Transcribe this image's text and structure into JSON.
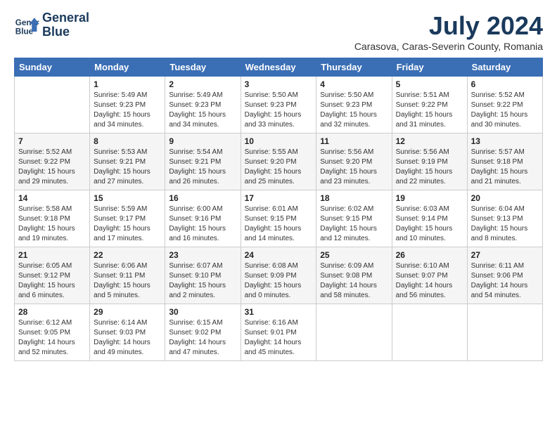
{
  "header": {
    "logo_line1": "General",
    "logo_line2": "Blue",
    "month": "July 2024",
    "location": "Carasova, Caras-Severin County, Romania"
  },
  "days_of_week": [
    "Sunday",
    "Monday",
    "Tuesday",
    "Wednesday",
    "Thursday",
    "Friday",
    "Saturday"
  ],
  "weeks": [
    [
      {
        "day": "",
        "content": ""
      },
      {
        "day": "1",
        "content": "Sunrise: 5:49 AM\nSunset: 9:23 PM\nDaylight: 15 hours\nand 34 minutes."
      },
      {
        "day": "2",
        "content": "Sunrise: 5:49 AM\nSunset: 9:23 PM\nDaylight: 15 hours\nand 34 minutes."
      },
      {
        "day": "3",
        "content": "Sunrise: 5:50 AM\nSunset: 9:23 PM\nDaylight: 15 hours\nand 33 minutes."
      },
      {
        "day": "4",
        "content": "Sunrise: 5:50 AM\nSunset: 9:23 PM\nDaylight: 15 hours\nand 32 minutes."
      },
      {
        "day": "5",
        "content": "Sunrise: 5:51 AM\nSunset: 9:22 PM\nDaylight: 15 hours\nand 31 minutes."
      },
      {
        "day": "6",
        "content": "Sunrise: 5:52 AM\nSunset: 9:22 PM\nDaylight: 15 hours\nand 30 minutes."
      }
    ],
    [
      {
        "day": "7",
        "content": "Sunrise: 5:52 AM\nSunset: 9:22 PM\nDaylight: 15 hours\nand 29 minutes."
      },
      {
        "day": "8",
        "content": "Sunrise: 5:53 AM\nSunset: 9:21 PM\nDaylight: 15 hours\nand 27 minutes."
      },
      {
        "day": "9",
        "content": "Sunrise: 5:54 AM\nSunset: 9:21 PM\nDaylight: 15 hours\nand 26 minutes."
      },
      {
        "day": "10",
        "content": "Sunrise: 5:55 AM\nSunset: 9:20 PM\nDaylight: 15 hours\nand 25 minutes."
      },
      {
        "day": "11",
        "content": "Sunrise: 5:56 AM\nSunset: 9:20 PM\nDaylight: 15 hours\nand 23 minutes."
      },
      {
        "day": "12",
        "content": "Sunrise: 5:56 AM\nSunset: 9:19 PM\nDaylight: 15 hours\nand 22 minutes."
      },
      {
        "day": "13",
        "content": "Sunrise: 5:57 AM\nSunset: 9:18 PM\nDaylight: 15 hours\nand 21 minutes."
      }
    ],
    [
      {
        "day": "14",
        "content": "Sunrise: 5:58 AM\nSunset: 9:18 PM\nDaylight: 15 hours\nand 19 minutes."
      },
      {
        "day": "15",
        "content": "Sunrise: 5:59 AM\nSunset: 9:17 PM\nDaylight: 15 hours\nand 17 minutes."
      },
      {
        "day": "16",
        "content": "Sunrise: 6:00 AM\nSunset: 9:16 PM\nDaylight: 15 hours\nand 16 minutes."
      },
      {
        "day": "17",
        "content": "Sunrise: 6:01 AM\nSunset: 9:15 PM\nDaylight: 15 hours\nand 14 minutes."
      },
      {
        "day": "18",
        "content": "Sunrise: 6:02 AM\nSunset: 9:15 PM\nDaylight: 15 hours\nand 12 minutes."
      },
      {
        "day": "19",
        "content": "Sunrise: 6:03 AM\nSunset: 9:14 PM\nDaylight: 15 hours\nand 10 minutes."
      },
      {
        "day": "20",
        "content": "Sunrise: 6:04 AM\nSunset: 9:13 PM\nDaylight: 15 hours\nand 8 minutes."
      }
    ],
    [
      {
        "day": "21",
        "content": "Sunrise: 6:05 AM\nSunset: 9:12 PM\nDaylight: 15 hours\nand 6 minutes."
      },
      {
        "day": "22",
        "content": "Sunrise: 6:06 AM\nSunset: 9:11 PM\nDaylight: 15 hours\nand 5 minutes."
      },
      {
        "day": "23",
        "content": "Sunrise: 6:07 AM\nSunset: 9:10 PM\nDaylight: 15 hours\nand 2 minutes."
      },
      {
        "day": "24",
        "content": "Sunrise: 6:08 AM\nSunset: 9:09 PM\nDaylight: 15 hours\nand 0 minutes."
      },
      {
        "day": "25",
        "content": "Sunrise: 6:09 AM\nSunset: 9:08 PM\nDaylight: 14 hours\nand 58 minutes."
      },
      {
        "day": "26",
        "content": "Sunrise: 6:10 AM\nSunset: 9:07 PM\nDaylight: 14 hours\nand 56 minutes."
      },
      {
        "day": "27",
        "content": "Sunrise: 6:11 AM\nSunset: 9:06 PM\nDaylight: 14 hours\nand 54 minutes."
      }
    ],
    [
      {
        "day": "28",
        "content": "Sunrise: 6:12 AM\nSunset: 9:05 PM\nDaylight: 14 hours\nand 52 minutes."
      },
      {
        "day": "29",
        "content": "Sunrise: 6:14 AM\nSunset: 9:03 PM\nDaylight: 14 hours\nand 49 minutes."
      },
      {
        "day": "30",
        "content": "Sunrise: 6:15 AM\nSunset: 9:02 PM\nDaylight: 14 hours\nand 47 minutes."
      },
      {
        "day": "31",
        "content": "Sunrise: 6:16 AM\nSunset: 9:01 PM\nDaylight: 14 hours\nand 45 minutes."
      },
      {
        "day": "",
        "content": ""
      },
      {
        "day": "",
        "content": ""
      },
      {
        "day": "",
        "content": ""
      }
    ]
  ]
}
